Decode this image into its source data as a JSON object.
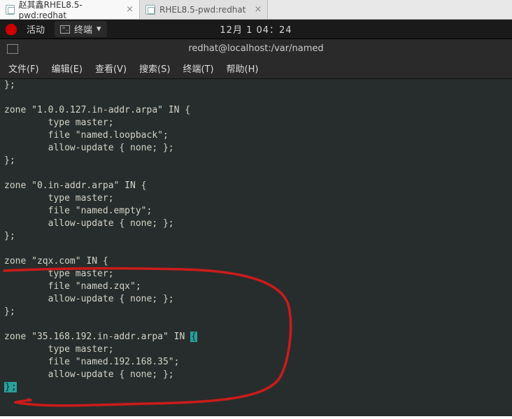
{
  "browser_tabs": [
    {
      "label": "赵其鑫RHEL8.5-pwd:redhat",
      "active": true
    },
    {
      "label": "RHEL8.5-pwd:redhat",
      "active": false
    }
  ],
  "gnome_top": {
    "activities": "活动",
    "app_label": "终端",
    "clock": "12月 1 04：24"
  },
  "term_title": "redhat@localhost:/var/named",
  "menubar": {
    "file": "文件(F)",
    "edit": "编辑(E)",
    "view": "查看(V)",
    "search": "搜索(S)",
    "terminal": "终端(T)",
    "help": "帮助(H)"
  },
  "terminal_lines": [
    "};",
    "",
    "zone \"1.0.0.127.in-addr.arpa\" IN {",
    "        type master;",
    "        file \"named.loopback\";",
    "        allow-update { none; };",
    "};",
    "",
    "zone \"0.in-addr.arpa\" IN {",
    "        type master;",
    "        file \"named.empty\";",
    "        allow-update { none; };",
    "};",
    "",
    "zone \"zqx.com\" IN {",
    "        type master;",
    "        file \"named.zqx\";",
    "        allow-update { none; };",
    "};",
    "",
    "zone \"35.168.192.in-addr.arpa\" IN ",
    "        type master;",
    "        file \"named.192.168.35\";",
    "        allow-update { none; };"
  ],
  "terminal_line_match_brace": "{",
  "terminal_lastline_prefix": "}",
  "terminal_lastline_cursor": ";"
}
